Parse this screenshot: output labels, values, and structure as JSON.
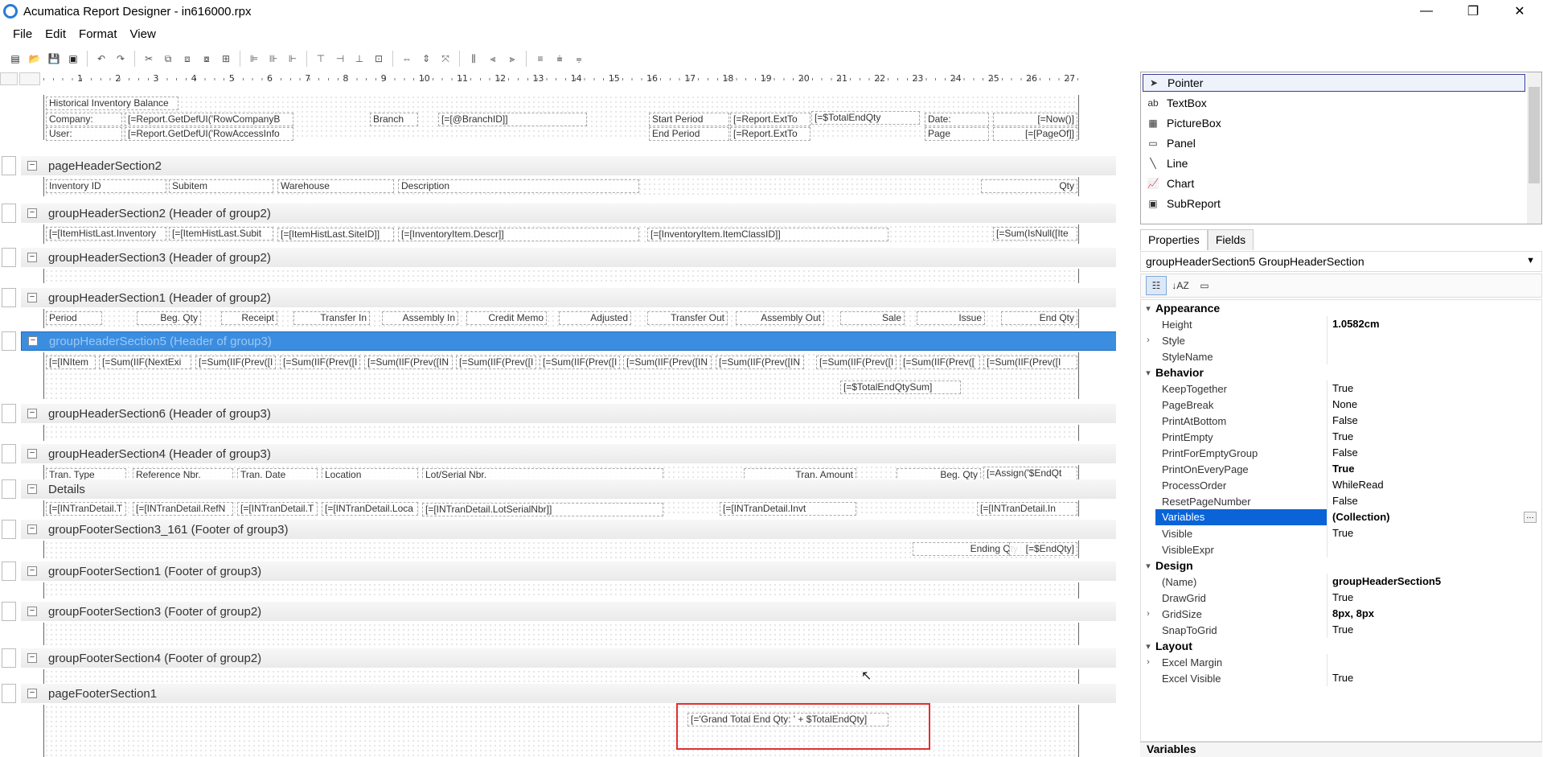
{
  "window": {
    "title": "Acumatica Report Designer - in616000.rpx",
    "minimize": "—",
    "restore": "❐",
    "close": "✕"
  },
  "menu": [
    "File",
    "Edit",
    "Format",
    "View"
  ],
  "ruler": [
    "1",
    "2",
    "3",
    "4",
    "5",
    "6",
    "7",
    "8",
    "9",
    "10",
    "11",
    "12",
    "13",
    "14",
    "15",
    "16",
    "17",
    "18",
    "19",
    "20",
    "21",
    "22",
    "23",
    "24",
    "25",
    "26",
    "27"
  ],
  "sections": {
    "top_band": {
      "title_field": "Historical Inventory Balance",
      "company_label": "Company:",
      "company_value": "[=Report.GetDefUI('RowCompanyB",
      "branch_label": "Branch",
      "branch_value": "[=[@BranchID]]",
      "start_period_label": "Start Period",
      "start_period_value": "[=Report.ExtTo",
      "total_end_qty": "[=$TotalEndQty",
      "date_label": "Date:",
      "date_value": "[=Now()]",
      "user_label": "User:",
      "user_value": "[=Report.GetDefUI('RowAccessInfo",
      "end_period_label": "End Period",
      "end_period_value": "[=Report.ExtTo",
      "page_label": "Page",
      "page_value": "[=[PageOf]]"
    },
    "pageHeader2": {
      "title": "pageHeaderSection2",
      "fields": [
        "Inventory ID",
        "Subitem",
        "Warehouse",
        "Description",
        "Qty"
      ]
    },
    "groupHeader2": {
      "title": "groupHeaderSection2 (Header of group2)",
      "fields": [
        "[=[ItemHistLast.Inventory",
        "[=[ItemHistLast.Subit",
        "[=[ItemHistLast.SiteID]]",
        "[=[InventoryItem.Descr]]",
        "[=[InventoryItem.ItemClassID]]",
        "[=Sum(IsNull([Ite"
      ]
    },
    "groupHeader3": {
      "title": "groupHeaderSection3 (Header of group2)"
    },
    "groupHeader1": {
      "title": "groupHeaderSection1 (Header of group2)",
      "fields": [
        "Period",
        "Beg. Qty",
        "Receipt",
        "Transfer In",
        "Assembly In",
        "Credit Memo",
        "Adjusted",
        "Transfer Out",
        "Assembly Out",
        "Sale",
        "Issue",
        "End Qty"
      ]
    },
    "groupHeader5": {
      "title": "groupHeaderSection5 (Header of group3)",
      "fields": [
        "[=[INItem",
        "[=Sum(IIF(NextExi",
        "[=Sum(IIF(Prev([I",
        "[=Sum(IIF(Prev([I",
        "[=Sum(IIF(Prev([IN",
        "[=Sum(IIF(Prev([I",
        "[=Sum(IIF(Prev([I",
        "[=Sum(IIF(Prev([IN",
        "[=Sum(IIF(Prev([IN",
        "[=Sum(IIF(Prev([I",
        "[=Sum(IIF(Prev([",
        "[=Sum(IIF(Prev([I"
      ],
      "sum_field": "[=$TotalEndQtySum]"
    },
    "groupHeader6": {
      "title": "groupHeaderSection6 (Header of group3)"
    },
    "groupHeader4": {
      "title": "groupHeaderSection4 (Header of group3)",
      "fields": [
        "Tran. Type",
        "Reference Nbr.",
        "Tran. Date",
        "Location",
        "Lot/Serial Nbr.",
        "Tran. Amount",
        "Beg. Qty",
        "[=Assign('$EndQt"
      ]
    },
    "details": {
      "title": "Details",
      "fields": [
        "[=[INTranDetail.T",
        "[=[INTranDetail.RefN",
        "[=[INTranDetail.T",
        "[=[INTranDetail.Loca",
        "[=[INTranDetail.LotSerialNbr]]",
        "[=[INTranDetail.Invt",
        "[=[INTranDetail.In"
      ]
    },
    "groupFooter3_161": {
      "title": "groupFooterSection3_161 (Footer of group3)",
      "ending_label": "Ending Qty",
      "ending_value": "[=$EndQty]"
    },
    "groupFooter1": {
      "title": "groupFooterSection1 (Footer of group3)"
    },
    "groupFooter3": {
      "title": "groupFooterSection3 (Footer of group2)"
    },
    "groupFooter4": {
      "title": "groupFooterSection4 (Footer of group2)"
    },
    "pageFooter1": {
      "title": "pageFooterSection1",
      "grand_total": "[='Grand Total End Qty: ' + $TotalEndQty]"
    }
  },
  "toolbox": {
    "items": [
      {
        "label": "Pointer",
        "icon": "pointer-icon"
      },
      {
        "label": "TextBox",
        "icon": "textbox-icon"
      },
      {
        "label": "PictureBox",
        "icon": "picturebox-icon"
      },
      {
        "label": "Panel",
        "icon": "panel-icon"
      },
      {
        "label": "Line",
        "icon": "line-icon"
      },
      {
        "label": "Chart",
        "icon": "chart-icon"
      },
      {
        "label": "SubReport",
        "icon": "subreport-icon"
      }
    ]
  },
  "tabs": {
    "properties": "Properties",
    "fields": "Fields"
  },
  "object_selector": "groupHeaderSection5 GroupHeaderSection",
  "properties": {
    "appearance": "Appearance",
    "height_name": "Height",
    "height_value": "1.0582cm",
    "style_name": "Style",
    "style_value": "",
    "stylename_name": "StyleName",
    "stylename_value": "",
    "behavior": "Behavior",
    "keeptogether_name": "KeepTogether",
    "keeptogether_value": "True",
    "pagebreak_name": "PageBreak",
    "pagebreak_value": "None",
    "printatbottom_name": "PrintAtBottom",
    "printatbottom_value": "False",
    "printempty_name": "PrintEmpty",
    "printempty_value": "True",
    "printforemptygroup_name": "PrintForEmptyGroup",
    "printforemptygroup_value": "False",
    "printoneverypage_name": "PrintOnEveryPage",
    "printoneverypage_value": "True",
    "processorder_name": "ProcessOrder",
    "processorder_value": "WhileRead",
    "resetpagenumber_name": "ResetPageNumber",
    "resetpagenumber_value": "False",
    "variables_name": "Variables",
    "variables_value": "(Collection)",
    "visible_name": "Visible",
    "visible_value": "True",
    "visibleexpr_name": "VisibleExpr",
    "visibleexpr_value": "",
    "design": "Design",
    "name_name": "(Name)",
    "name_value": "groupHeaderSection5",
    "drawgrid_name": "DrawGrid",
    "drawgrid_value": "True",
    "gridsize_name": "GridSize",
    "gridsize_value": "8px, 8px",
    "snaptogrid_name": "SnapToGrid",
    "snaptogrid_value": "True",
    "layout": "Layout",
    "excelmargin_name": "Excel Margin",
    "excelmargin_value": "",
    "excelvisible_name": "Excel Visible",
    "excelvisible_value": "True"
  },
  "description_title": "Variables",
  "colors": {
    "selection_blue": "#3b8de0",
    "highlight_red": "#e03030",
    "prop_select": "#0a64d8"
  }
}
